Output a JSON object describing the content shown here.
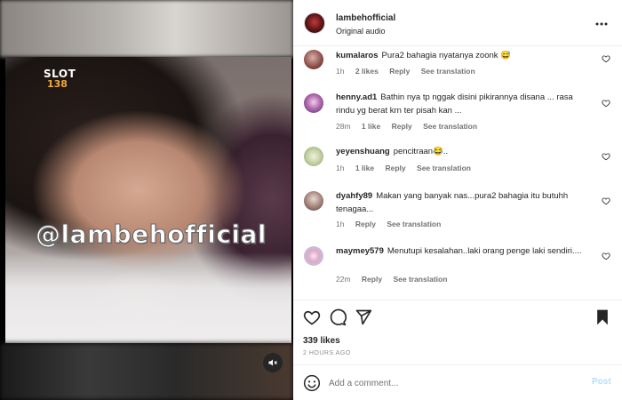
{
  "media": {
    "brand_line1": "SLOT",
    "brand_line2": "138",
    "watermark": "@lambehofficial",
    "mute_icon": "speaker-muted-icon"
  },
  "header": {
    "username": "lambehofficial",
    "audio": "Original audio",
    "more_icon": "more-horizontal-icon"
  },
  "comments": [
    {
      "username": "kumalaros",
      "text": "Pura2 bahagia nyatanya zoonk 😅",
      "time": "1h",
      "likes": "2 likes",
      "reply": "Reply",
      "translation": "See translation"
    },
    {
      "username": "henny.ad1",
      "text": "Bathin nya tp nggak disini pikirannya disana ... rasa rindu yg berat krn ter pisah kan ...",
      "time": "28m",
      "likes": "1 like",
      "reply": "Reply",
      "translation": "See translation"
    },
    {
      "username": "yeyenshuang",
      "text": "pencitraan😂..",
      "time": "1h",
      "likes": "1 like",
      "reply": "Reply",
      "translation": "See translation"
    },
    {
      "username": "dyahfy89",
      "text": "Makan yang banyak nas...pura2 bahagia itu butuhh tenagaa...",
      "time": "1h",
      "likes": "",
      "reply": "Reply",
      "translation": "See translation"
    },
    {
      "username": "maymey579",
      "text": "Menutupi kesalahan..laki orang penge laki sendiri....",
      "time": "22m",
      "likes": "",
      "reply": "Reply",
      "translation": "See translation"
    }
  ],
  "post": {
    "likes": "339 likes",
    "time": "2 HOURS AGO"
  },
  "add_comment": {
    "placeholder": "Add a comment...",
    "post_label": "Post"
  },
  "colors": {
    "text": "#262626",
    "muted": "#737373",
    "post_disabled": "#b2dffc"
  }
}
